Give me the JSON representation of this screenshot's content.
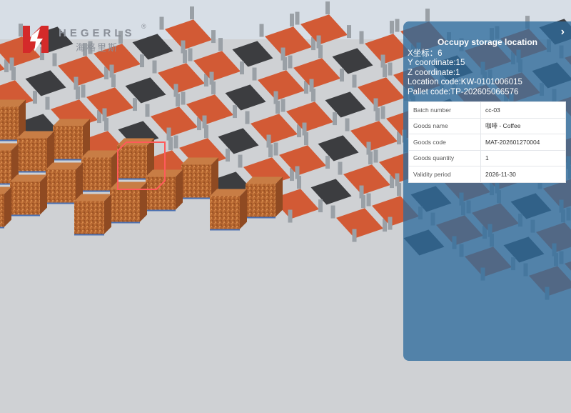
{
  "logo": {
    "brand": "HEGERLS",
    "reg": "®",
    "cn": "海格里斯"
  },
  "panel": {
    "title": "Occupy storage location",
    "coords": {
      "x": "X坐标：6",
      "y": "Y coordinate:15",
      "z": "Z coordinate:1",
      "location": "Location code:KW-0101006015",
      "pallet": "Pallet code:TP-202605066576"
    },
    "rows": [
      {
        "label": "Batch number",
        "value": "cc-03"
      },
      {
        "label": "Goods name",
        "value": "咖啡 - Coffee"
      },
      {
        "label": "Goods code",
        "value": "MAT-202601270004"
      },
      {
        "label": "Goods quantity",
        "value": "1"
      },
      {
        "label": "Validity period",
        "value": "2026-11-30"
      }
    ]
  },
  "colors": {
    "floor": "#cfd1d4",
    "sky": "#d7dee6",
    "cargo": "#b8693a",
    "pallet_orange": "#d25a35",
    "dark_tile": "#3c3d40",
    "rack_post": "#9aa0a6",
    "highlight": "#ff5a5a"
  }
}
